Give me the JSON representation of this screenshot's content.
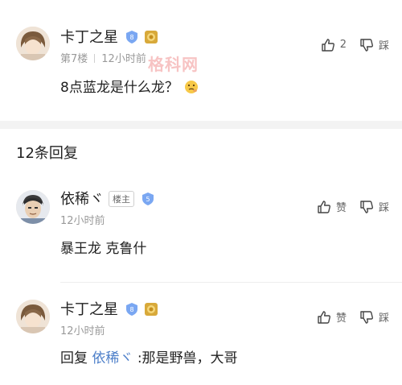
{
  "colors": {
    "accent": "#4d7fc9",
    "muted": "#9a9a9a",
    "badge_blue": "#7aa7f2",
    "badge_gold": "#d8a93a"
  },
  "main_comment": {
    "author": "卡丁之星",
    "level": "8",
    "floor": "第7楼",
    "time": "12小时前",
    "text": "8点蓝龙是什么龙？",
    "emoji": "thinking-face-icon",
    "like_count": "2",
    "dislike_label": "踩"
  },
  "watermark": "格科网",
  "replies_header": "12条回复",
  "replies": [
    {
      "author": "依稀ヾ",
      "tag": "楼主",
      "level": "5",
      "time": "12小时前",
      "text": "暴王龙 克鲁什",
      "like_label": "赞",
      "dislike_label": "踩"
    },
    {
      "author": "卡丁之星",
      "level": "8",
      "time": "12小时前",
      "reply_prefix": "回复",
      "reply_to": "依稀ヾ",
      "text": ":那是野兽，大哥",
      "like_label": "赞",
      "dislike_label": "踩"
    }
  ]
}
